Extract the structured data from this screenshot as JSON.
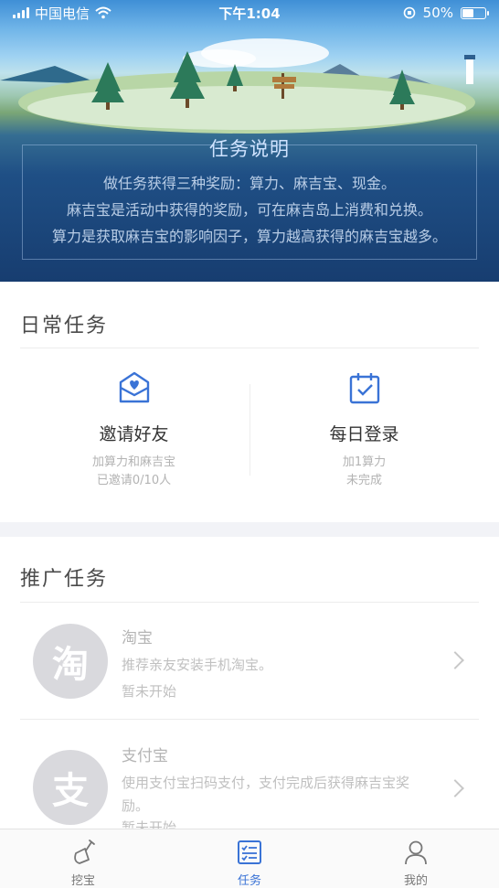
{
  "status_bar": {
    "carrier": "中国电信",
    "time": "下午1:04",
    "battery": "50%",
    "battery_level": 0.5
  },
  "intro": {
    "title": "任务说明",
    "lines": [
      "做任务获得三种奖励：算力、麻吉宝、现金。",
      "麻吉宝是活动中获得的奖励，可在麻吉岛上消费和兑换。",
      "算力是获取麻吉宝的影响因子，算力越高获得的麻吉宝越多。"
    ]
  },
  "daily": {
    "title": "日常任务",
    "items": [
      {
        "name": "邀请好友",
        "reward": "加算力和麻吉宝",
        "status": "已邀请0/10人",
        "icon": "invite-envelope-icon"
      },
      {
        "name": "每日登录",
        "reward": "加1算力",
        "status": "未完成",
        "icon": "calendar-check-icon"
      }
    ]
  },
  "promo": {
    "title": "推广任务",
    "items": [
      {
        "avatar": "淘",
        "name": "淘宝",
        "desc": "推荐亲友安装手机淘宝。",
        "status": "暂未开始"
      },
      {
        "avatar": "支",
        "name": "支付宝",
        "desc": "使用支付宝扫码支付，支付完成后获得麻吉宝奖励。",
        "status": "暂未开始"
      }
    ]
  },
  "tabs": [
    {
      "label": "挖宝",
      "icon": "shovel-icon",
      "active": false
    },
    {
      "label": "任务",
      "icon": "task-list-icon",
      "active": true
    },
    {
      "label": "我的",
      "icon": "person-icon",
      "active": false
    }
  ],
  "colors": {
    "accent": "#3a73d6",
    "hero_dark": "#173d70",
    "muted": "#b3b3b3"
  }
}
